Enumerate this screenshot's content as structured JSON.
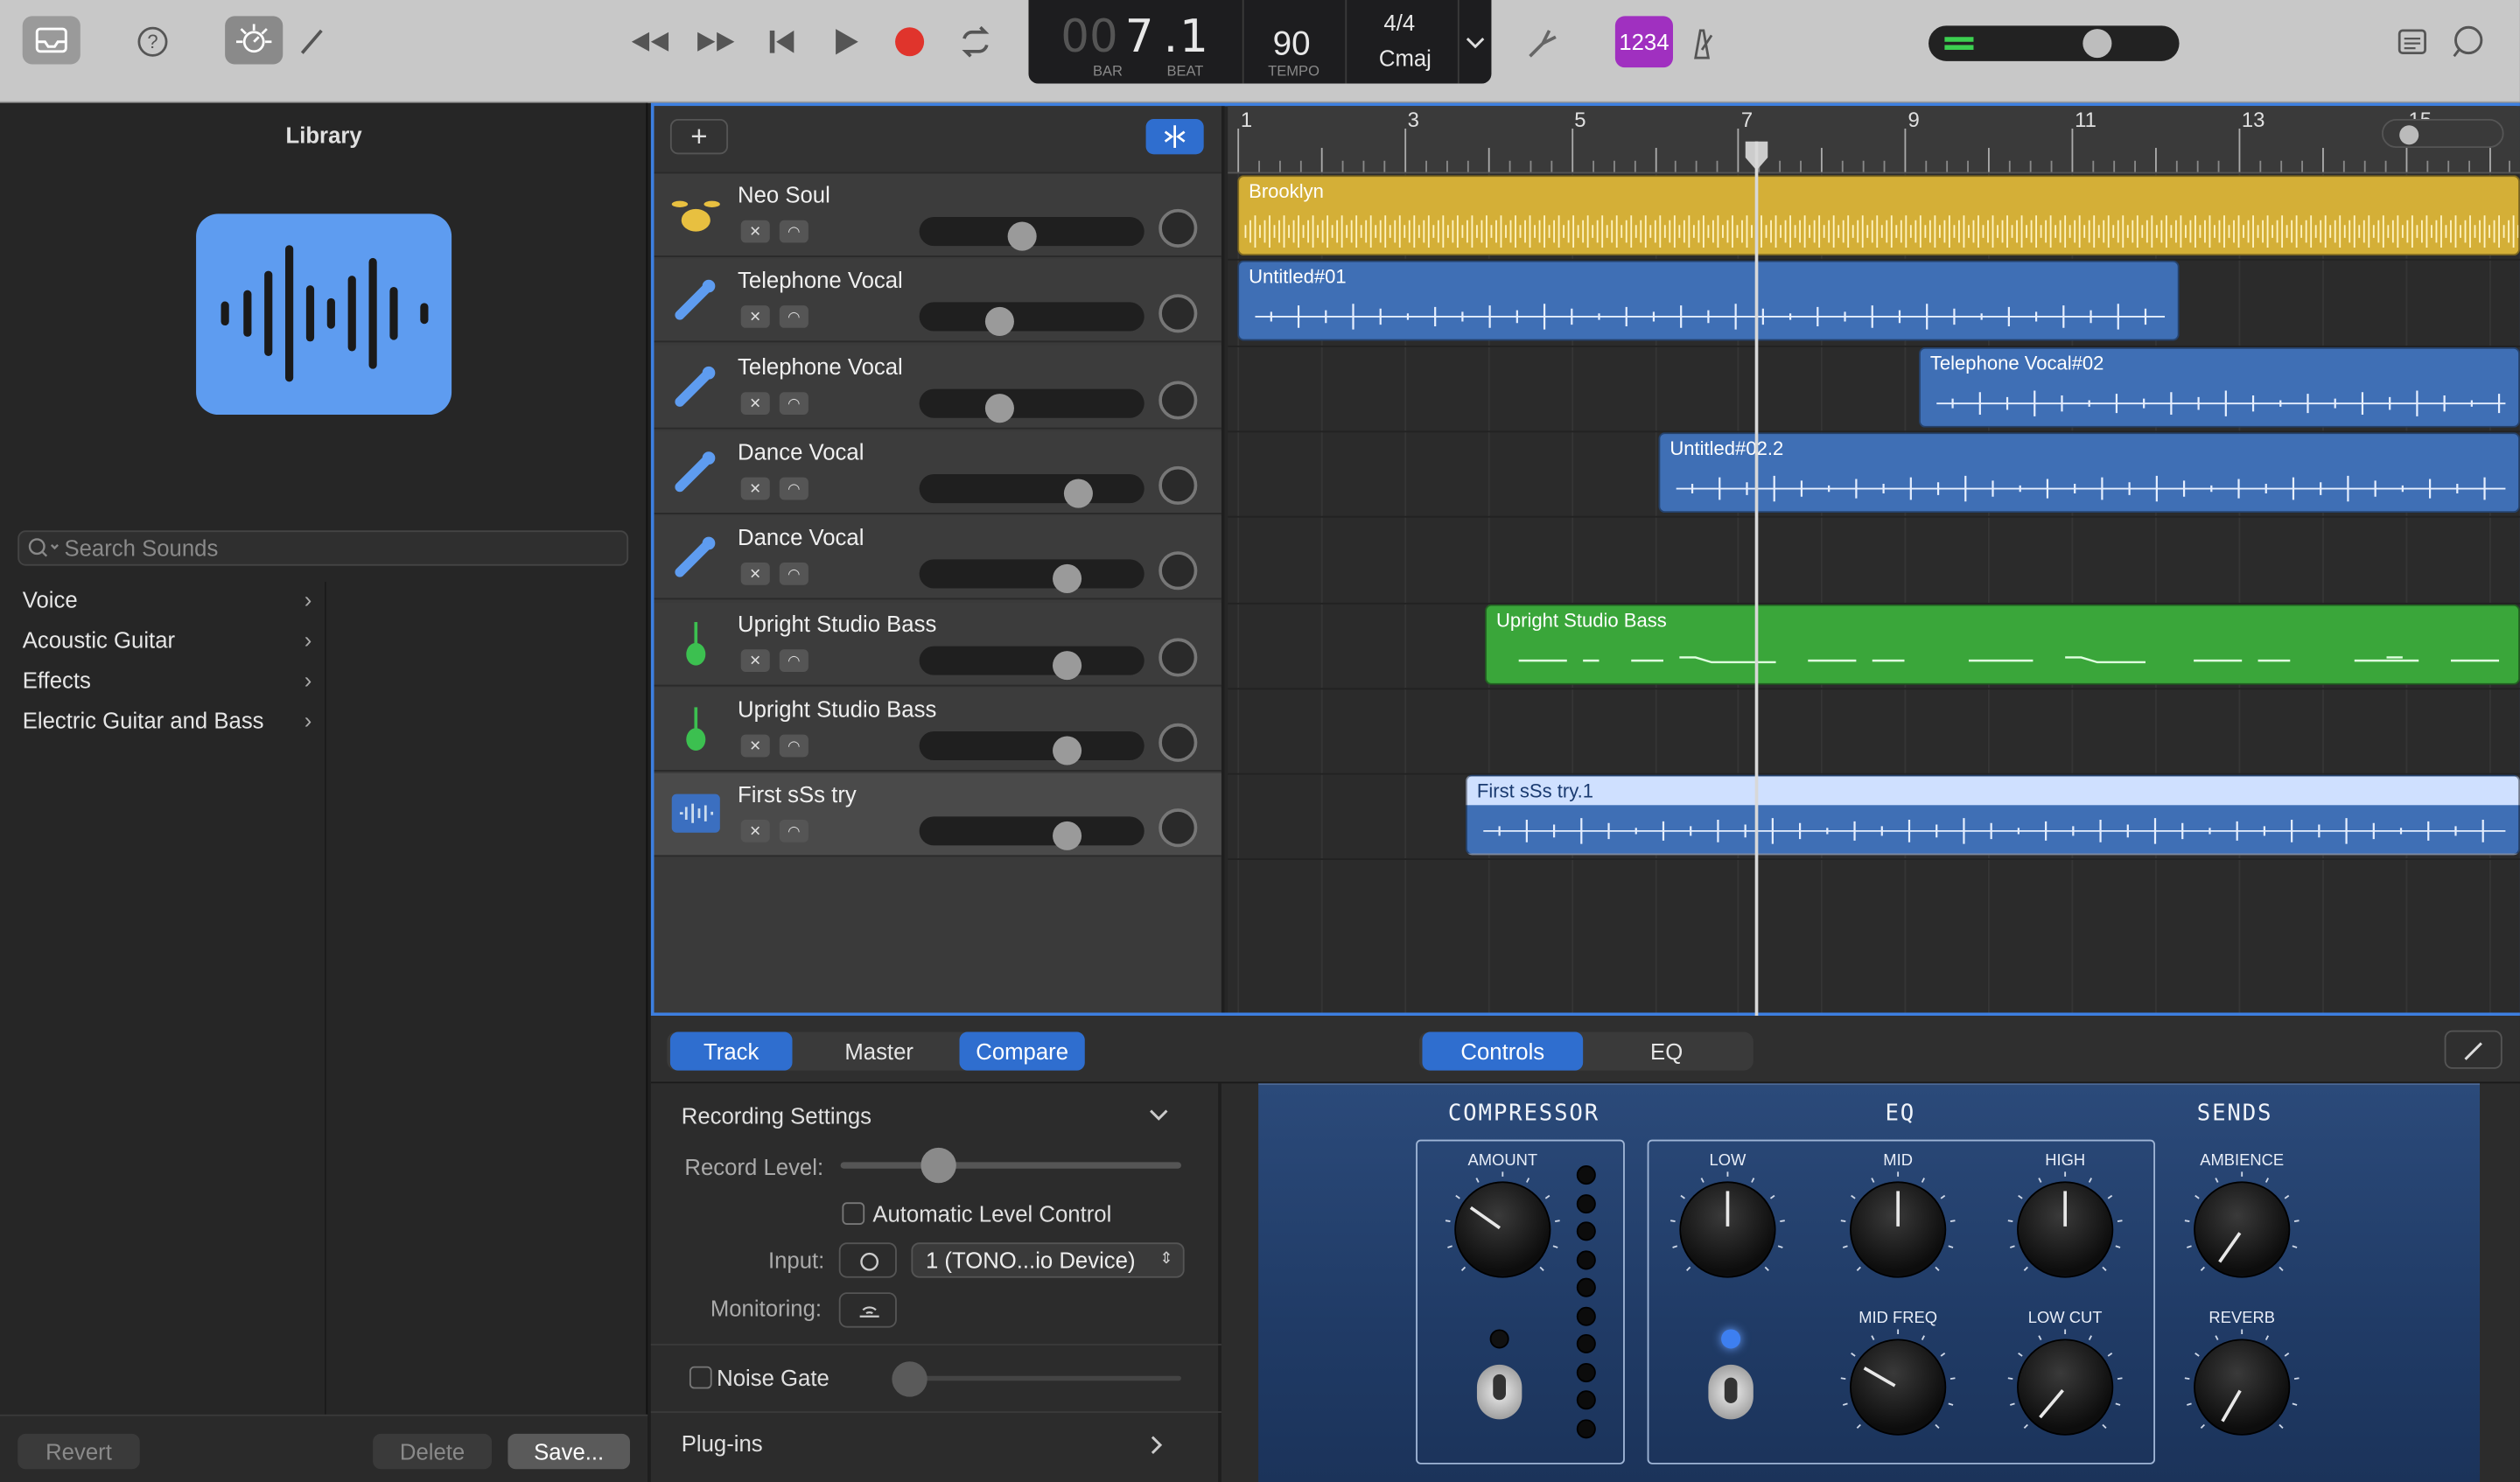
{
  "toolbar": {
    "lcd": {
      "bar_dim": "00",
      "bar_value": "7",
      "beat_value": "1",
      "bar_label": "BAR",
      "beat_label": "BEAT",
      "tempo": "90",
      "tempo_label": "TEMPO",
      "time_sig": "4/4",
      "key": "Cmaj"
    },
    "count_in": "1234"
  },
  "library": {
    "title": "Library",
    "search_placeholder": "Search Sounds",
    "categories": [
      "Voice",
      "Acoustic Guitar",
      "Effects",
      "Electric Guitar and Bass"
    ],
    "revert": "Revert",
    "delete": "Delete",
    "save": "Save..."
  },
  "ruler": {
    "bars": [
      "1",
      "3",
      "5",
      "7",
      "9",
      "11",
      "13",
      "15"
    ]
  },
  "tracks": [
    {
      "name": "Neo Soul",
      "icon": "drum-kit-icon",
      "volume": 0.45
    },
    {
      "name": "Telephone Vocal",
      "icon": "microphone-icon",
      "volume": 0.34
    },
    {
      "name": "Telephone Vocal",
      "icon": "microphone-icon",
      "volume": 0.34
    },
    {
      "name": "Dance Vocal",
      "icon": "microphone-icon",
      "volume": 0.74
    },
    {
      "name": "Dance Vocal",
      "icon": "microphone-icon",
      "volume": 0.68
    },
    {
      "name": "Upright Studio Bass",
      "icon": "upright-bass-icon",
      "volume": 0.68
    },
    {
      "name": "Upright Studio Bass",
      "icon": "upright-bass-icon",
      "volume": 0.68
    },
    {
      "name": "First sSs try",
      "icon": "audio-waveform-icon",
      "volume": 0.68
    }
  ],
  "regions": [
    {
      "label": "Brooklyn",
      "color": "#d4af37"
    },
    {
      "label": "Untitled#01",
      "color": "#3f6fb5"
    },
    {
      "label": "Telephone Vocal#02",
      "color": "#3f6fb5"
    },
    {
      "label": "Untitled#02.2",
      "color": "#3f6fb5"
    },
    {
      "label": "Upright Studio Bass",
      "color": "#3aa63a"
    },
    {
      "label": "First sSs try.1",
      "color": "#3f6fb5"
    }
  ],
  "inspector": {
    "tabs": [
      "Track",
      "Master",
      "Compare"
    ],
    "recording_settings": "Recording Settings",
    "record_level": "Record Level:",
    "auto_level": "Automatic Level Control",
    "input_label": "Input:",
    "input_value": "1 (TONO...io Device)",
    "monitoring_label": "Monitoring:",
    "noise_gate": "Noise Gate",
    "plugins": "Plug-ins"
  },
  "smart_controls": {
    "tabs": [
      "Controls",
      "EQ"
    ],
    "sections": {
      "compressor": "COMPRESSOR",
      "eq": "EQ",
      "sends": "SENDS"
    },
    "knobs": {
      "amount": "AMOUNT",
      "low": "LOW",
      "mid": "MID",
      "high": "HIGH",
      "mid_freq": "MID FREQ",
      "low_cut": "LOW CUT",
      "ambience": "AMBIENCE",
      "reverb": "REVERB"
    }
  }
}
